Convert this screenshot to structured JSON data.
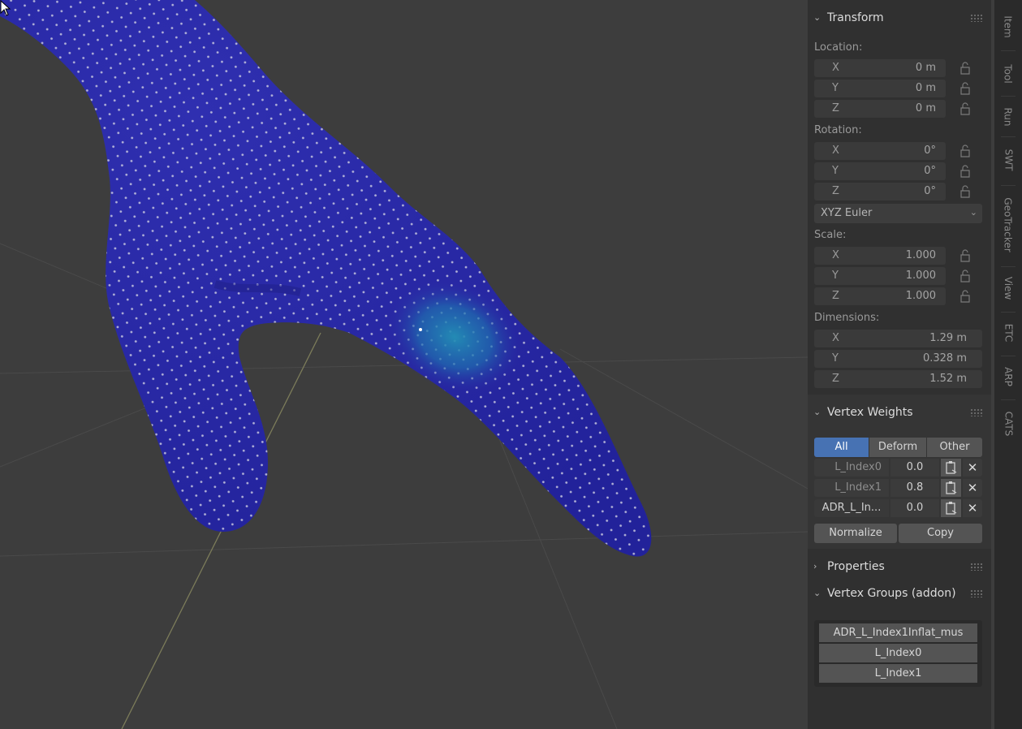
{
  "transform": {
    "title": "Transform",
    "location": {
      "label": "Location:",
      "x": {
        "axis": "X",
        "value": "0 m"
      },
      "y": {
        "axis": "Y",
        "value": "0 m"
      },
      "z": {
        "axis": "Z",
        "value": "0 m"
      }
    },
    "rotation": {
      "label": "Rotation:",
      "x": {
        "axis": "X",
        "value": "0°"
      },
      "y": {
        "axis": "Y",
        "value": "0°"
      },
      "z": {
        "axis": "Z",
        "value": "0°"
      },
      "mode": "XYZ Euler"
    },
    "scale": {
      "label": "Scale:",
      "x": {
        "axis": "X",
        "value": "1.000"
      },
      "y": {
        "axis": "Y",
        "value": "1.000"
      },
      "z": {
        "axis": "Z",
        "value": "1.000"
      }
    },
    "dimensions": {
      "label": "Dimensions:",
      "x": {
        "axis": "X",
        "value": "1.29 m"
      },
      "y": {
        "axis": "Y",
        "value": "0.328 m"
      },
      "z": {
        "axis": "Z",
        "value": "1.52 m"
      }
    }
  },
  "vertex_weights": {
    "title": "Vertex Weights",
    "filters": [
      "All",
      "Deform",
      "Other"
    ],
    "active_filter": "All",
    "rows": [
      {
        "name": "L_Index0",
        "value": "0.0"
      },
      {
        "name": "L_Index1",
        "value": "0.8"
      },
      {
        "name": "ADR_L_In...",
        "value": "0.0"
      }
    ],
    "normalize_label": "Normalize",
    "copy_label": "Copy"
  },
  "properties": {
    "title": "Properties"
  },
  "vertex_groups": {
    "title": "Vertex Groups (addon)",
    "items": [
      "ADR_L_Index1Inflat_mus",
      "L_Index0",
      "L_Index1"
    ]
  },
  "tabs": [
    "Item",
    "Tool",
    "Run",
    "SWT",
    "GeoTracker",
    "View",
    "ETC",
    "ARP",
    "CATS"
  ],
  "colors": {
    "mesh": "#2b2ba6",
    "highlight": "#1f7fb0",
    "active_filter": "#4772b3"
  },
  "icons": [
    "lock-icon",
    "paste-icon",
    "close-icon",
    "chevron-down-icon",
    "chevron-right-icon",
    "grip-icon",
    "cursor-icon"
  ]
}
